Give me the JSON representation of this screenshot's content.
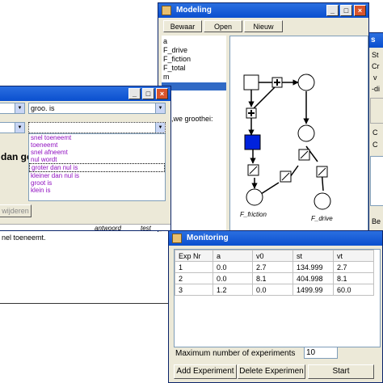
{
  "modeling": {
    "title": "Modeling",
    "toolbar": [
      "Bewaar",
      "Open",
      "Nieuw"
    ],
    "variables": [
      "a",
      "F_drive",
      "F_fiction",
      "F_total",
      "m"
    ],
    "relation_label": "hie,we groothei:",
    "node_labels": {
      "friction": "F_friction",
      "drive": "F_drive"
    }
  },
  "left_window": {
    "dropdown_top_value": "groo. is",
    "big_text": "dan ge",
    "options": [
      "snel toeneemt",
      "toeneemt",
      "snel afneemt",
      "nul wordt",
      "groter dan nul is",
      "kleiner dan nul is",
      "groot is",
      "klein is"
    ],
    "button_label": "wijderen",
    "col_answer": "antwoord",
    "col_test": "test",
    "row_text": "nel toeneemt."
  },
  "monitoring": {
    "title": "Monitoring",
    "columns": [
      "Exp Nr",
      "a",
      "v0",
      "st",
      "vt"
    ],
    "rows": [
      [
        "1",
        "0.0",
        "2.7",
        "134.999",
        "2.7"
      ],
      [
        "2",
        "0.0",
        "8.1",
        "404.998",
        "8.1"
      ],
      [
        "3",
        "1.2",
        "0.0",
        "1499.99",
        "60.0"
      ]
    ],
    "max_label": "Maximum number of experiments",
    "max_value": "10",
    "add_label": "Add Experiment",
    "delete_label": "Delete Experimen",
    "start_label": "Start"
  },
  "right_panel": {
    "title_char": "s",
    "labels": [
      "St",
      "Cr",
      "v",
      "-di"
    ],
    "radio_labels": [
      "C",
      "C"
    ],
    "bottom_label": "Be"
  },
  "colors": {
    "titlebar": "#0a4fcf",
    "selected_node": "#0022dd",
    "purple_text": "#9010c0"
  }
}
